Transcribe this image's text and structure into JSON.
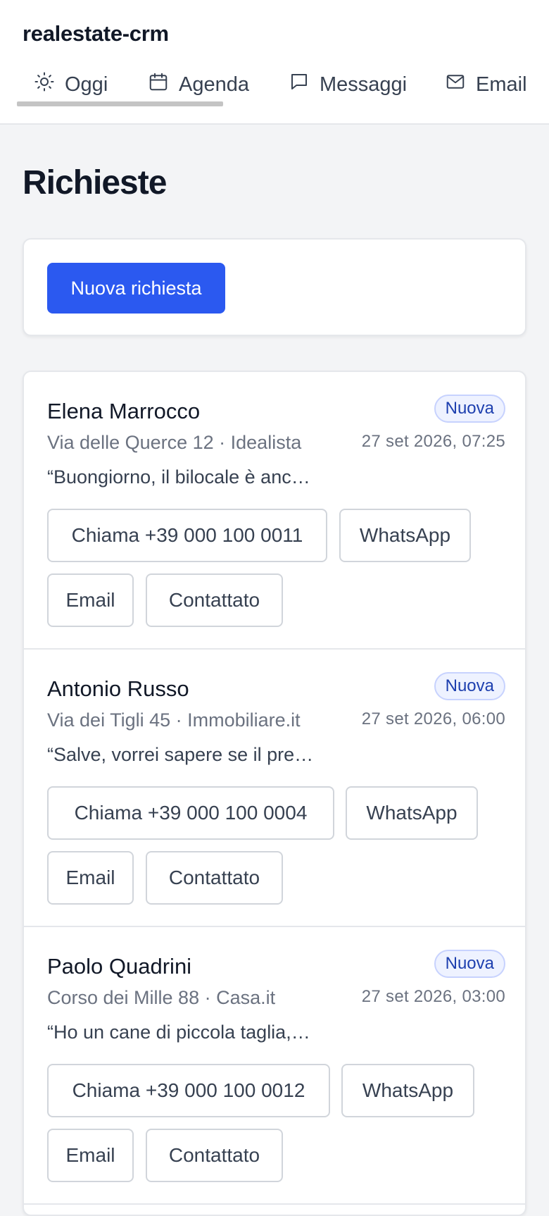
{
  "header": {
    "app_title": "realestate-crm",
    "tabs": [
      {
        "label": "Oggi",
        "icon": "sun-icon",
        "active": true
      },
      {
        "label": "Agenda",
        "icon": "calendar-icon"
      },
      {
        "label": "Messaggi",
        "icon": "chat-icon"
      },
      {
        "label": "Email",
        "icon": "mail-icon"
      }
    ]
  },
  "main": {
    "title": "Richieste",
    "new_request_label": "Nuova richiesta"
  },
  "colors": {
    "primary": "#2b59f0",
    "badge_text": "#1e40af",
    "badge_bg": "#eef2ff"
  },
  "leads": [
    {
      "name": "Elena Marrocco",
      "subtitle": "Via delle Querce 12 · Idealista",
      "message": "“Buongiorno, il bilocale è anc…",
      "status": "Nuova",
      "time": "27 set 2026, 07:25",
      "call_label": "Chiama +39 000 100 0011",
      "whatsapp_label": "WhatsApp",
      "email_label": "Email",
      "contacted_label": "Contattato"
    },
    {
      "name": "Antonio Russo",
      "subtitle": "Via dei Tigli 45 · Immobiliare.it",
      "message": "“Salve, vorrei sapere se il pre…",
      "status": "Nuova",
      "time": "27 set 2026, 06:00",
      "call_label": "Chiama +39 000 100 0004",
      "whatsapp_label": "WhatsApp",
      "email_label": "Email",
      "contacted_label": "Contattato"
    },
    {
      "name": "Paolo Quadrini",
      "subtitle": "Corso dei Mille 88 · Casa.it",
      "message": "“Ho un cane di piccola taglia,…",
      "status": "Nuova",
      "time": "27 set 2026, 03:00",
      "call_label": "Chiama +39 000 100 0012",
      "whatsapp_label": "WhatsApp",
      "email_label": "Email",
      "contacted_label": "Contattato"
    }
  ]
}
